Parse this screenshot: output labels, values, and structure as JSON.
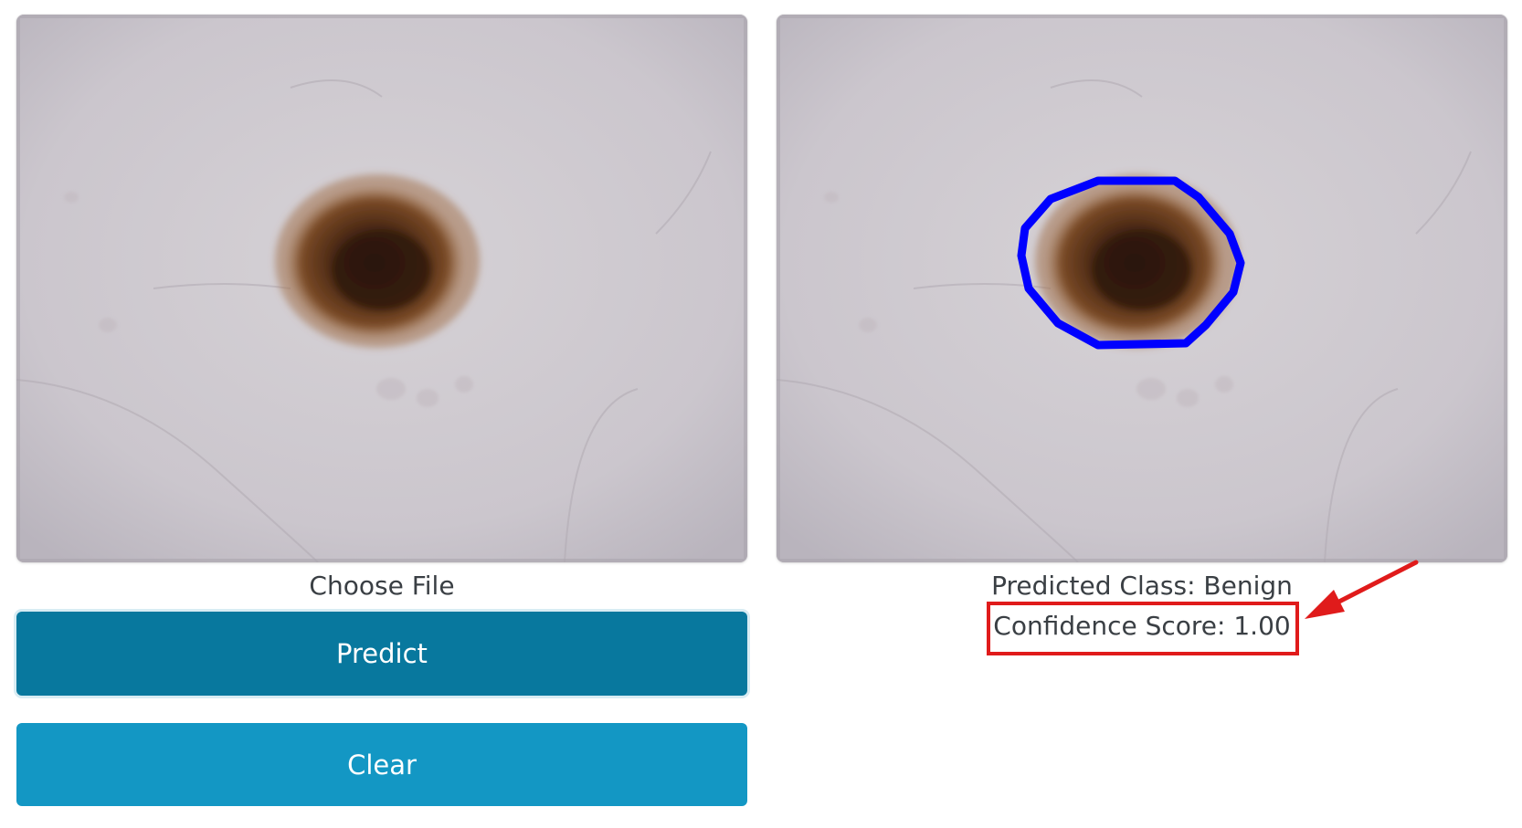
{
  "input": {
    "choose_file_label": "Choose File",
    "image_description_icon": "skin-lesion-image"
  },
  "actions": {
    "predict_label": "Predict",
    "clear_label": "Clear"
  },
  "result": {
    "predicted_class": "Predicted Class: Benign",
    "confidence_score": "Confidence Score: 1.00",
    "segmentation_outline_color": "#0000ff"
  },
  "annotation": {
    "highlight_color": "#e01b1b"
  },
  "colors": {
    "predict_button": "#08789e",
    "clear_button": "#1397c4"
  }
}
